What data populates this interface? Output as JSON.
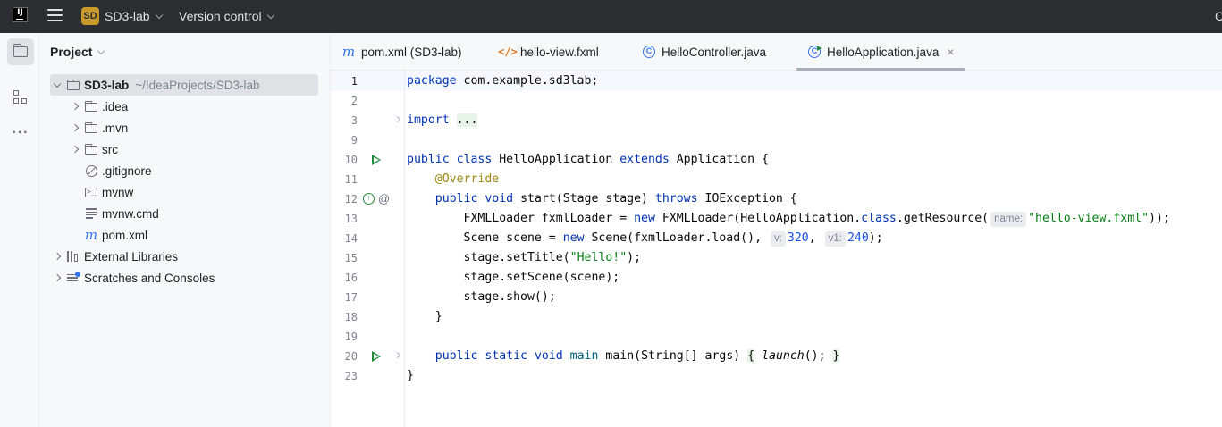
{
  "titlebar": {
    "logo": "IJ",
    "project_badge": "SD",
    "project_name": "SD3-lab",
    "vcs_label": "Version control",
    "right_label": "C"
  },
  "project_panel": {
    "title": "Project",
    "tree": [
      {
        "label": "SD3-lab",
        "path": "~/IdeaProjects/SD3-lab",
        "icon": "folder-icon",
        "expanded": true,
        "selected": true
      },
      {
        "label": ".idea",
        "icon": "folder-icon",
        "collapsed": true
      },
      {
        "label": ".mvn",
        "icon": "folder-icon",
        "collapsed": true
      },
      {
        "label": "src",
        "icon": "folder-icon",
        "collapsed": true
      },
      {
        "label": ".gitignore",
        "icon": "ignore-file-icon"
      },
      {
        "label": "mvnw",
        "icon": "terminal-file-icon"
      },
      {
        "label": "mvnw.cmd",
        "icon": "text-file-icon"
      },
      {
        "label": "pom.xml",
        "icon": "maven-icon"
      },
      {
        "label": "External Libraries",
        "icon": "library-icon",
        "collapsed": true
      },
      {
        "label": "Scratches and Consoles",
        "icon": "scratches-icon",
        "collapsed": true
      }
    ]
  },
  "tabs": [
    {
      "label": "pom.xml (SD3-lab)",
      "icon": "maven-icon"
    },
    {
      "label": "hello-view.fxml",
      "icon": "fxml-icon"
    },
    {
      "label": "HelloController.java",
      "icon": "java-class-icon"
    },
    {
      "label": "HelloApplication.java",
      "icon": "java-run-class-icon",
      "active": true,
      "close": "×"
    }
  ],
  "editor": {
    "line_numbers": [
      "1",
      "2",
      "3",
      "9",
      "10",
      "11",
      "12",
      "13",
      "14",
      "15",
      "16",
      "17",
      "18",
      "19",
      "20",
      "23"
    ],
    "hints": {
      "name": "name:",
      "v": "v:",
      "v1": "v1:"
    },
    "lines": {
      "l1": {
        "kw": "package",
        "rest": " com.example.sd3lab;"
      },
      "l3": {
        "kw": "import",
        "fold": "..."
      },
      "l10": {
        "kw1": "public",
        "kw2": "class",
        "name": " HelloApplication ",
        "kw3": "extends",
        "rest": " Application {"
      },
      "l11": {
        "ann": "@Override"
      },
      "l12": {
        "kw1": "public",
        "kw2": "void",
        "rest1": " start(Stage stage) ",
        "kw3": "throws",
        "rest2": " IOException {"
      },
      "l13": {
        "a": "FXMLLoader fxmlLoader = ",
        "kw1": "new",
        "b": " FXMLLoader(HelloApplication.",
        "kw2": "class",
        "c": ".getResource(",
        "str": "\"hello-view.fxml\"",
        "d": "));"
      },
      "l14": {
        "a": "Scene scene = ",
        "kw": "new",
        "b": " Scene(fxmlLoader.load(), ",
        "n1": "320",
        "c": ", ",
        "n2": "240",
        "d": ");"
      },
      "l15": {
        "a": "stage.setTitle(",
        "str": "\"Hello!\"",
        "b": ");"
      },
      "l16": {
        "text": "stage.setScene(scene);"
      },
      "l17": {
        "text": "stage.show();"
      },
      "l18": {
        "text": "}"
      },
      "l20": {
        "kw1": "public",
        "kw2": "static",
        "kw3": "void",
        "rest": " main(String[] args) ",
        "fold_open": "{",
        "call": " launch",
        "call_rest": "(); ",
        "fold_close": "}"
      },
      "l23": {
        "text": "}"
      }
    }
  }
}
